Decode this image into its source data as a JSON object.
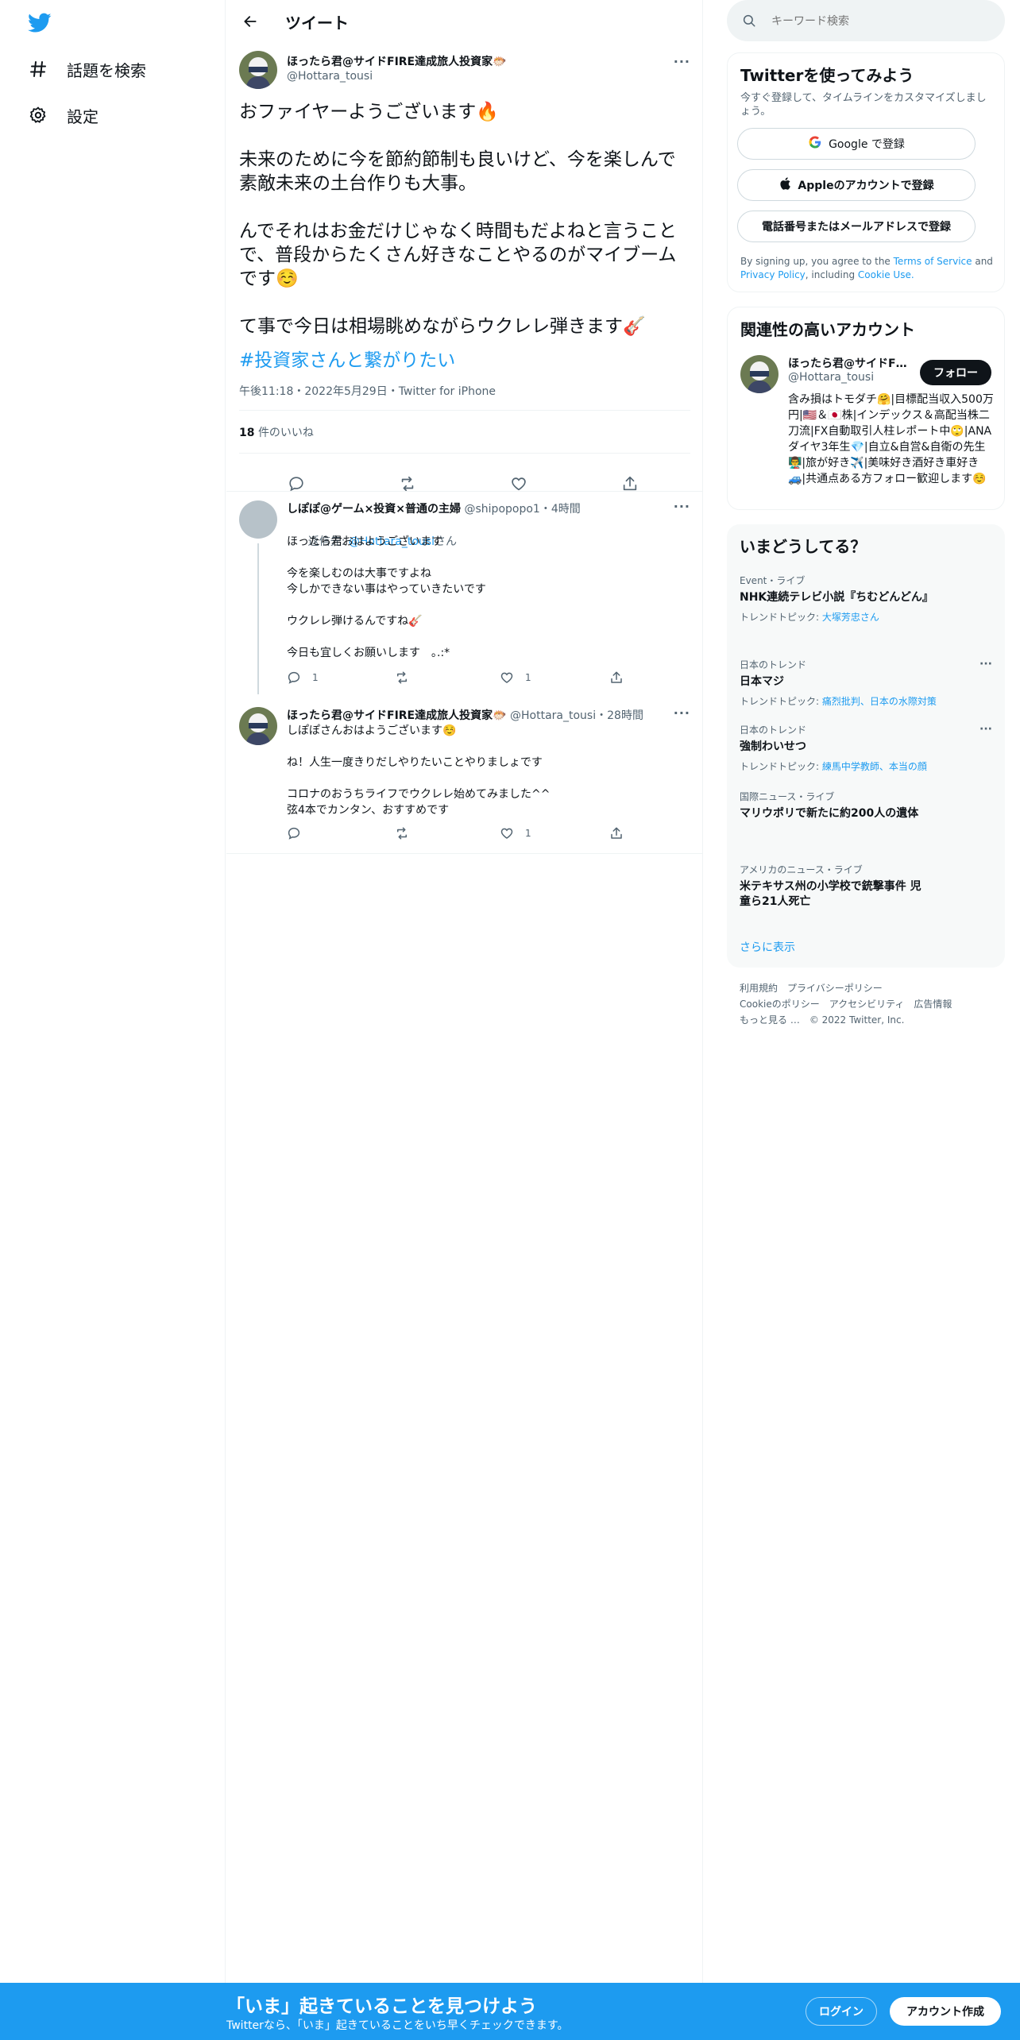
{
  "nav": {
    "explore_label": "話題を検索",
    "settings_label": "設定"
  },
  "header": {
    "title": "ツイート"
  },
  "tweet": {
    "author": "ほったら君@サイドFIRE達成旅人投資家🐡",
    "handle": "@Hottara_tousi",
    "text": "おファイヤーようございます🔥\n\n未来のために今を節約節制も良いけど、今を楽しんで素敵未来の土台作りも大事。\n\nんでそれはお金だけじゃなく時間もだよねと言うことで、普段からたくさん好きなことやるのがマイブームです☺️\n\nて事で今日は相場眺めながらウクレレ弾きます🎸",
    "hashtag": "#投資家さんと繋がりたい",
    "meta": "午後11:18・2022年5月29日・Twitter for iPhone",
    "likes_count": "18",
    "likes_label": "件のいいね"
  },
  "replies": [
    {
      "author": "しぽぽ@ゲーム×投資×普通の主婦",
      "handle": "@shipopopo1",
      "time": "・4時間",
      "reply_to_prefix": "返信先: ",
      "reply_to_handle": "@Hottara_tousi",
      "reply_to_suffix": "さん",
      "text": "ほったら君おはようございます\n\n今を楽しむのは大事ですよね\n今しかできない事はやっていきたいです\n\nウクレレ弾けるんですね🎸\n\n今日も宜しくお願いします　｡.:*",
      "replies": "1",
      "retweets": "",
      "likes": "1"
    },
    {
      "author": "ほったら君@サイドFIRE達成旅人投資家🐡",
      "handle": "@Hottara_tousi",
      "time": "・28時間",
      "text": "しぽぽさんおはようございます☺️\n\nね！人生一度きりだしやりたいことやりましょです\n\nコロナのおうちライフでウクレレ始めてみました^^\n弦4本でカンタン、おすすめです",
      "replies": "",
      "retweets": "",
      "likes": "1"
    }
  ],
  "search": {
    "placeholder": "キーワード検索"
  },
  "signup": {
    "title": "Twitterを使ってみよう",
    "subtitle": "今すぐ登録して、タイムラインをカスタマイズしましょう。",
    "google_label": "Google で登録",
    "apple_label": "Appleのアカウントで登録",
    "phone_label": "電話番号またはメールアドレスで登録",
    "legal_prefix": "By signing up, you agree to the ",
    "terms": "Terms of Service",
    "and": " and ",
    "privacy": "Privacy Policy",
    "including": ", including ",
    "cookie": "Cookie Use."
  },
  "related": {
    "title": "関連性の高いアカウント",
    "name": "ほったら君@サイドFIRE達成旅人投資家🐡",
    "handle": "@Hottara_tousi",
    "follow_label": "フォロー",
    "bio": "含み損はトモダチ🤗|目標配当収入500万円|🇺🇸＆🇯🇵株|インデックス＆高配当株二刀流|FX自動取引人柱レポート中🙄|ANAダイヤ3年生💎|自立&自営&自衛の先生👨‍🏫|旅が好き✈️|美味好き酒好き車好き🚙|共通点ある方フォロー歓迎します☺️"
  },
  "trends": {
    "title": "いまどうしてる？",
    "items": [
      {
        "category": "Event・ライブ",
        "title": "NHK連続テレビ小説『ちむどんどん』",
        "topic_prefix": "トレンドトピック: ",
        "topics": "大塚芳忠さん"
      },
      {
        "category": "日本のトレンド",
        "title": "日本マジ",
        "topic_prefix": "トレンドトピック: ",
        "topics": "痛烈批判、日本の水際対策"
      },
      {
        "category": "日本のトレンド",
        "title": "強制わいせつ",
        "topic_prefix": "トレンドトピック: ",
        "topics": "練馬中学教師、本当の顔"
      },
      {
        "category": "国際ニュース・ライブ",
        "title": "マリウポリで新たに約200人の遺体",
        "topic_prefix": "",
        "topics": ""
      },
      {
        "category": "アメリカのニュース・ライブ",
        "title": "米テキサス州の小学校で銃撃事件 児童ら21人死亡",
        "topic_prefix": "",
        "topics": ""
      }
    ],
    "show_more": "さらに表示"
  },
  "footer": {
    "terms": "利用規約",
    "privacy": "プライバシーポリシー",
    "cookie": "Cookieのポリシー",
    "accessibility": "アクセシビリティ",
    "ads": "広告情報",
    "more": "もっと見る …",
    "copyright": "© 2022 Twitter, Inc."
  },
  "bottom": {
    "title": "「いま」起きていることを見つけよう",
    "subtitle": "Twitterなら、「いま」起きていることをいち早くチェックできます。",
    "login": "ログイン",
    "signup": "アカウント作成"
  },
  "colors": {
    "accent": "#1d9bf0",
    "text": "#0f1419",
    "muted": "#536471"
  }
}
